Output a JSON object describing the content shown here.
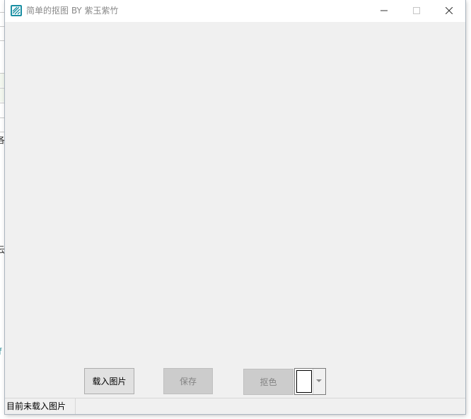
{
  "window": {
    "title": "简单的抠图 BY 紫玉紫竹",
    "accent": "#1a8fa3"
  },
  "toolbar": {
    "load_label": "载入图片",
    "save_label": "保存",
    "key_label": "抠色",
    "color_value": "#ffffff"
  },
  "status": {
    "text": "目前未载入图片"
  },
  "background_window": {
    "fragments": [
      "各",
      "云",
      "f"
    ]
  },
  "icons": {
    "app": "app-icon",
    "minimize": "minimize-icon",
    "maximize": "maximize-icon",
    "close": "close-icon",
    "dropdown": "chevron-down-icon"
  }
}
